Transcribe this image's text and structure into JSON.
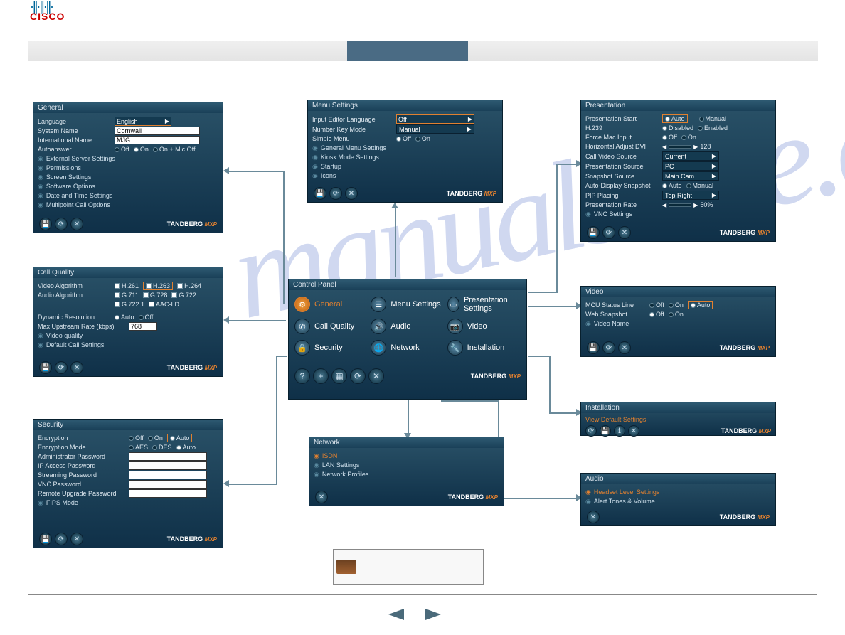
{
  "logo": {
    "vendor": "CISCO"
  },
  "panels": {
    "general": {
      "title": "General",
      "rows": {
        "language": {
          "label": "Language",
          "value": "English"
        },
        "system_name": {
          "label": "System Name",
          "value": "Cornwall"
        },
        "intl_name": {
          "label": "International Name",
          "value": "MJG"
        },
        "autoanswer": {
          "label": "Autoanswer",
          "opts": [
            "Off",
            "On",
            "On + Mic Off"
          ],
          "sel": "On"
        }
      },
      "links": [
        "External Server Settings",
        "Permissions",
        "Screen Settings",
        "Software Options",
        "Date and Time Settings",
        "Multipoint Call Options"
      ]
    },
    "callq": {
      "title": "Call Quality",
      "video": {
        "label": "Video Algorithm",
        "opts": [
          "H.261",
          "H.263",
          "H.264"
        ],
        "boxed": "H.263"
      },
      "audio": {
        "label": "Audio Algorithm",
        "opts1": [
          "G.711",
          "G.728",
          "G.722"
        ],
        "opts2": [
          "G.722.1",
          "AAC-LD"
        ]
      },
      "dyn": {
        "label": "Dynamic Resolution",
        "opts": [
          "Auto",
          "Off"
        ],
        "sel": "Auto"
      },
      "rate": {
        "label": "Max Upstream Rate (kbps)",
        "value": "768"
      },
      "links": [
        "Video quality",
        "Default Call Settings"
      ]
    },
    "security": {
      "title": "Security",
      "enc": {
        "label": "Encryption",
        "opts": [
          "Off",
          "On",
          "Auto"
        ],
        "sel": "Auto"
      },
      "encmode": {
        "label": "Encryption Mode",
        "opts": [
          "AES",
          "DES",
          "Auto"
        ],
        "sel": "Auto"
      },
      "pwds": [
        "Administrator Password",
        "IP Access Password",
        "Streaming Password",
        "VNC Password",
        "Remote Upgrade Password"
      ],
      "fips": "FIPS Mode"
    },
    "menu": {
      "title": "Menu Settings",
      "lang": {
        "label": "Input Editor Language",
        "value": "Off"
      },
      "numkey": {
        "label": "Number Key Mode",
        "value": "Manual"
      },
      "simple": {
        "label": "Simple Menu",
        "opts": [
          "Off",
          "On"
        ],
        "sel": "Off"
      },
      "links": [
        "General Menu Settings",
        "Kiosk Mode Settings",
        "Startup",
        "Icons"
      ]
    },
    "control": {
      "title": "Control Panel",
      "items": [
        {
          "label": "General",
          "sel": true
        },
        {
          "label": "Menu Settings"
        },
        {
          "label": "Presentation Settings"
        },
        {
          "label": "Call Quality"
        },
        {
          "label": "Audio"
        },
        {
          "label": "Video"
        },
        {
          "label": "Security"
        },
        {
          "label": "Network"
        },
        {
          "label": "Installation"
        }
      ]
    },
    "network": {
      "title": "Network",
      "links": [
        {
          "label": "ISDN",
          "orange": true
        },
        {
          "label": "LAN Settings"
        },
        {
          "label": "Network Profiles"
        }
      ]
    },
    "presentation": {
      "title": "Presentation",
      "rows": {
        "start": {
          "label": "Presentation Start",
          "opts": [
            "Auto",
            "Manual"
          ],
          "sel": "Auto",
          "boxed": true
        },
        "h239": {
          "label": "H.239",
          "opts": [
            "Disabled",
            "Enabled"
          ],
          "sel": "Disabled"
        },
        "mac": {
          "label": "Force Mac Input",
          "opts": [
            "Off",
            "On"
          ],
          "sel": "Off"
        },
        "horiz": {
          "label": "Horizontal Adjust DVI",
          "value": "128"
        },
        "cvs": {
          "label": "Call Video Source",
          "value": "Current"
        },
        "ps": {
          "label": "Presentation Source",
          "value": "PC"
        },
        "ss": {
          "label": "Snapshot Source",
          "value": "Main Cam"
        },
        "ads": {
          "label": "Auto-Display Snapshot",
          "opts": [
            "Auto",
            "Manual"
          ],
          "sel": "Auto"
        },
        "pip": {
          "label": "PIP Placing",
          "value": "Top Right"
        },
        "rate": {
          "label": "Presentation Rate",
          "value": "50%"
        }
      },
      "links": [
        "VNC Settings"
      ]
    },
    "video": {
      "title": "Video",
      "mcu": {
        "label": "MCU Status Line",
        "opts": [
          "Off",
          "On",
          "Auto"
        ],
        "sel": "Auto",
        "boxed": true
      },
      "web": {
        "label": "Web Snapshot",
        "opts": [
          "Off",
          "On"
        ],
        "sel": "Off"
      },
      "links": [
        "Video Name"
      ]
    },
    "install": {
      "title": "Installation",
      "link": "View Default Settings"
    },
    "audio": {
      "title": "Audio",
      "links": [
        {
          "label": "Headset Level Settings",
          "orange": true
        },
        {
          "label": "Alert Tones & Volume"
        }
      ]
    }
  },
  "tandberg": {
    "brand": "TANDBERG",
    "suffix": "MXP"
  }
}
